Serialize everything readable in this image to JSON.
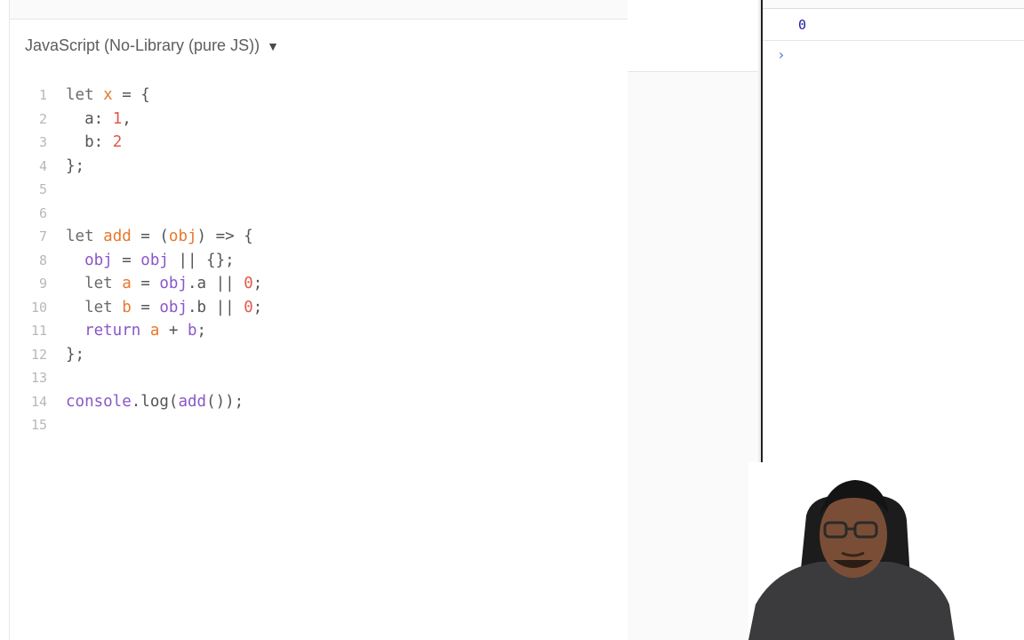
{
  "editor": {
    "language_label": "JavaScript (No-Library (pure JS))",
    "caret": "▼",
    "lines": [
      {
        "n": "1",
        "tokens": [
          [
            "kw",
            "let "
          ],
          [
            "var",
            "x"
          ],
          [
            "pl",
            " = {"
          ]
        ]
      },
      {
        "n": "2",
        "tokens": [
          [
            "pl",
            "  a: "
          ],
          [
            "num",
            "1"
          ],
          [
            "pl",
            ","
          ]
        ]
      },
      {
        "n": "3",
        "tokens": [
          [
            "pl",
            "  b: "
          ],
          [
            "num",
            "2"
          ]
        ]
      },
      {
        "n": "4",
        "tokens": [
          [
            "pl",
            "};"
          ]
        ]
      },
      {
        "n": "5",
        "tokens": []
      },
      {
        "n": "6",
        "tokens": []
      },
      {
        "n": "7",
        "tokens": [
          [
            "kw",
            "let "
          ],
          [
            "var",
            "add"
          ],
          [
            "pl",
            " = ("
          ],
          [
            "var",
            "obj"
          ],
          [
            "pl",
            ") => {"
          ]
        ]
      },
      {
        "n": "8",
        "tokens": [
          [
            "pl",
            "  "
          ],
          [
            "fn",
            "obj"
          ],
          [
            "pl",
            " = "
          ],
          [
            "fn",
            "obj"
          ],
          [
            "pl",
            " || {};"
          ]
        ]
      },
      {
        "n": "9",
        "tokens": [
          [
            "pl",
            "  "
          ],
          [
            "kw",
            "let "
          ],
          [
            "var",
            "a"
          ],
          [
            "pl",
            " = "
          ],
          [
            "fn",
            "obj"
          ],
          [
            "pl",
            ".a || "
          ],
          [
            "num",
            "0"
          ],
          [
            "pl",
            ";"
          ]
        ]
      },
      {
        "n": "10",
        "tokens": [
          [
            "pl",
            "  "
          ],
          [
            "kw",
            "let "
          ],
          [
            "var",
            "b"
          ],
          [
            "pl",
            " = "
          ],
          [
            "fn",
            "obj"
          ],
          [
            "pl",
            ".b || "
          ],
          [
            "num",
            "0"
          ],
          [
            "pl",
            ";"
          ]
        ]
      },
      {
        "n": "11",
        "tokens": [
          [
            "pl",
            "  "
          ],
          [
            "fn",
            "return "
          ],
          [
            "var",
            "a"
          ],
          [
            "pl",
            " + "
          ],
          [
            "fn",
            "b"
          ],
          [
            "pl",
            ";"
          ]
        ]
      },
      {
        "n": "12",
        "tokens": [
          [
            "pl",
            "};"
          ]
        ]
      },
      {
        "n": "13",
        "tokens": []
      },
      {
        "n": "14",
        "tokens": [
          [
            "fn",
            "console"
          ],
          [
            "pl",
            ".log("
          ],
          [
            "fn",
            "add"
          ],
          [
            "pl",
            "());"
          ]
        ]
      },
      {
        "n": "15",
        "tokens": []
      }
    ]
  },
  "console": {
    "output_value": "0",
    "prompt": "›"
  },
  "colors": {
    "keyword": "#6b6b6b",
    "variable": "#e8772c",
    "number": "#e15a4a",
    "function": "#8a57c7",
    "console_value": "#1a1aa6",
    "prompt": "#3b7ddd"
  }
}
